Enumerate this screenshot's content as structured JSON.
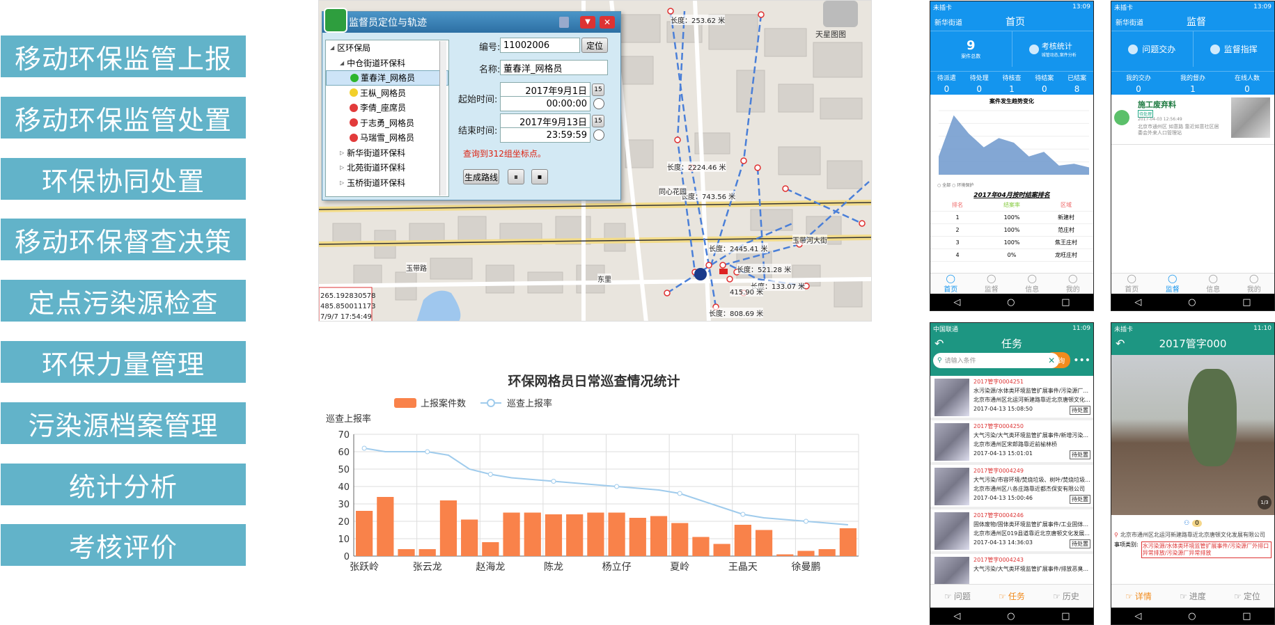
{
  "menu": [
    "移动环保监管上报",
    "移动环保监管处置",
    "环保协同处置",
    "移动环保督查决策",
    "定点污染源检查",
    "环保力量管理",
    "污染源档案管理",
    "统计分析",
    "考核评价"
  ],
  "map": {
    "dialog_title": "监督员定位与轨迹",
    "layer_label": "天星图图",
    "tree": [
      {
        "label": "区环保局",
        "level": 0,
        "dot": ""
      },
      {
        "label": "中仓街道环保科",
        "level": 1,
        "dot": ""
      },
      {
        "label": "董春洋_网格员",
        "level": 2,
        "dot": "#2db52d"
      },
      {
        "label": "王枞_网格员",
        "level": 2,
        "dot": "#f2d02a"
      },
      {
        "label": "李倩_座席员",
        "level": 2,
        "dot": "#e23b3b"
      },
      {
        "label": "于志勇_网格员",
        "level": 2,
        "dot": "#e23b3b"
      },
      {
        "label": "马瑞雪_网格员",
        "level": 2,
        "dot": "#e23b3b"
      },
      {
        "label": "新华街道环保科",
        "level": 1,
        "dot": ""
      },
      {
        "label": "北苑街道环保科",
        "level": 1,
        "dot": ""
      },
      {
        "label": "玉桥街道环保科",
        "level": 1,
        "dot": ""
      }
    ],
    "id_label": "编号:",
    "id_value": "11002006",
    "locate_btn": "定位",
    "name_label": "名称:",
    "name_value": "董春洋_网格员",
    "start_label": "起始时间:",
    "start_date": "2017年9月1日",
    "start_time": "00:00:00",
    "end_label": "结束时间:",
    "end_date": "2017年9月13日",
    "end_time": "23:59:59",
    "result": "查询到312组坐标点。",
    "route_btn": "生成路线",
    "calendar_icon_text": "15",
    "coords": [
      "265.192830578",
      "485.850011173",
      "7/9/7 17:54:49"
    ],
    "labels": [
      {
        "text": "长度：253.62 米"
      },
      {
        "text": "长度：2224.46 米"
      },
      {
        "text": "长度：743.56 米"
      },
      {
        "text": "长度：2445.41 米"
      },
      {
        "text": "长度：521.28 米"
      },
      {
        "text": "长度：133.07 米"
      },
      {
        "text": "长度：808.69 米"
      },
      {
        "text": "415.90 米"
      },
      {
        "text": "玉带路"
      },
      {
        "text": "玉带河大街"
      },
      {
        "text": "东里"
      },
      {
        "text": "同心花园"
      }
    ]
  },
  "chart_data": {
    "type": "bar",
    "title": "环保网格员日常巡查情况统计",
    "ylabel": "巡查上报率",
    "ylim": [
      0,
      70
    ],
    "yticks": [
      0,
      10,
      20,
      30,
      40,
      50,
      60,
      70
    ],
    "x_tick_labels": [
      "张跃岭",
      "张云龙",
      "赵海龙",
      "陈龙",
      "杨立仔",
      "夏岭",
      "王晶天",
      "徐曼鹏"
    ],
    "series": [
      {
        "name": "上报案件数",
        "type": "bar",
        "color": "#f9824a",
        "values": [
          26,
          34,
          4,
          4,
          32,
          21,
          8,
          25,
          25,
          24,
          24,
          25,
          25,
          22,
          23,
          19,
          11,
          7,
          18,
          15,
          1,
          3,
          4,
          16
        ]
      },
      {
        "name": "巡查上报率",
        "type": "line",
        "color": "#9fcbec",
        "values": [
          62,
          60,
          60,
          60,
          58,
          50,
          47,
          45,
          44,
          43,
          42,
          41,
          40,
          39,
          38,
          36,
          32,
          28,
          24,
          22,
          21,
          20,
          19,
          18
        ]
      }
    ]
  },
  "phone1": {
    "carrier": "未插卡",
    "time": "13:09",
    "location": "新华街道",
    "title": "首页",
    "count": "9",
    "count_label": "案件总数",
    "stats_title": "考核统计",
    "stats_sub": "城管动态,案件分析",
    "stats": [
      {
        "label": "待派遣",
        "value": "0"
      },
      {
        "label": "待处理",
        "value": "0"
      },
      {
        "label": "待核查",
        "value": "1"
      },
      {
        "label": "待结案",
        "value": "0"
      },
      {
        "label": "已结案",
        "value": "8"
      }
    ],
    "trend_title": "案件发生趋势变化",
    "trend_values": [
      20,
      65,
      45,
      30,
      40,
      35,
      20,
      25,
      10,
      12,
      8
    ],
    "legend": "○ 全部  ○ 环境保护",
    "rank_title": "2017年04月按时结案排名",
    "rank_header": [
      "排名",
      "结案率",
      "区域"
    ],
    "ranks": [
      [
        "1",
        "100%",
        "新建村"
      ],
      [
        "2",
        "100%",
        "范庄村"
      ],
      [
        "3",
        "100%",
        "焦王庄村"
      ],
      [
        "4",
        "0%",
        "龙旺庄村"
      ]
    ],
    "tabs": [
      "首页",
      "监督",
      "信息",
      "我的"
    ]
  },
  "phone2": {
    "carrier": "未插卡",
    "time": "13:09",
    "location": "新华街道",
    "title": "监督",
    "btn1": "问题交办",
    "btn2": "监督指挥",
    "stats": [
      {
        "label": "我的交办",
        "value": "0"
      },
      {
        "label": "我的督办",
        "value": "1"
      },
      {
        "label": "在线人数",
        "value": "0"
      }
    ],
    "item_title": "施工废弃料",
    "item_tag": "待处理",
    "item_date": "2017-04-03 12:56:49",
    "item_addr": "北京市通州区 如意路 靠近如意社区居委会外来人口管理站",
    "tabs": [
      "首页",
      "监督",
      "信息",
      "我的"
    ]
  },
  "phone3": {
    "carrier": "中国联通",
    "time": "11:09",
    "title": "任务",
    "search_placeholder": "请输入条件",
    "search_btn": "查询",
    "tasks": [
      {
        "id": "2017管字0004251",
        "t1": "水污染源/水体类环境监管扩展事件/污染源厂...",
        "t2": "北京市通州区北运河新建路靠近北京唐顿文化...",
        "date": "2017-04-13 15:08:50",
        "status": "待处置"
      },
      {
        "id": "2017管字0004250",
        "t1": "大气污染/大气类环境监管扩展事件/新增污染...",
        "t2": "北京市通州区宋郎路靠近前榆林桥",
        "date": "2017-04-13 15:01:01",
        "status": "待处置"
      },
      {
        "id": "2017管字0004249",
        "t1": "大气污染/市容环境/焚烧垃圾、树叶/焚烧垃圾...",
        "t2": "北京市通州区八各庄路靠近都杰保安有限公司",
        "date": "2017-04-13 15:00:46",
        "status": "待处置"
      },
      {
        "id": "2017管字0004246",
        "t1": "固体废物/固体类环境监管扩展事件/工业固体...",
        "t2": "北京市通州区019县道靠近北京唐顿文化发展...",
        "date": "2017-04-13 14:36:03",
        "status": "待处置"
      },
      {
        "id": "2017管字0004243",
        "t1": "大气污染/大气类环境监管扩展事件/排放恶臭...",
        "t2": "",
        "date": "",
        "status": ""
      }
    ],
    "tabs": [
      "问题",
      "任务",
      "历史"
    ]
  },
  "phone4": {
    "carrier": "未插卡",
    "time": "11:10",
    "title": "2017管字000",
    "page": "1/3",
    "views": "0",
    "address": "北京市通州区北运河新建路靠近北京唐顿文化发展有限公司",
    "type_label": "事项类别:",
    "type_value": "水污染源/水体类环境监管扩展事件/污染源厂外排口异常排放/污染源厂异常排放",
    "tabs": [
      "详情",
      "进度",
      "定位"
    ]
  }
}
